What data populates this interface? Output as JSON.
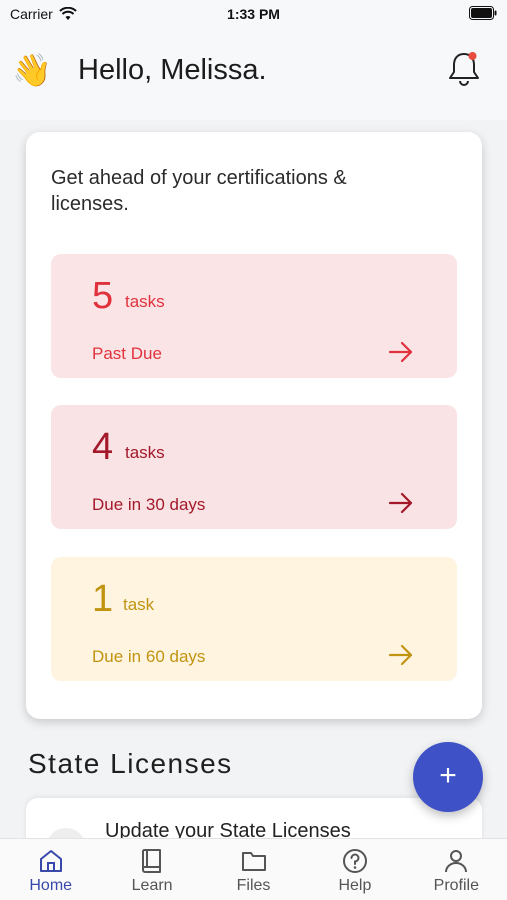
{
  "status_bar": {
    "carrier": "Carrier",
    "time": "1:33 PM"
  },
  "header": {
    "greeting": "Hello, Melissa.",
    "wave_emoji": "👋",
    "notification_icon": "bell-icon"
  },
  "summary_card": {
    "title": "Get ahead of your certifications & licenses.",
    "tasks": [
      {
        "count": "5",
        "unit": "tasks",
        "label": "Past Due",
        "color": "#e0323c",
        "background": "#fbe4e6"
      },
      {
        "count": "4",
        "unit": "tasks",
        "label": "Due in 30 days",
        "color": "#a3192a",
        "background": "#fae3e5"
      },
      {
        "count": "1",
        "unit": "task",
        "label": "Due in 60 days",
        "color": "#c09410",
        "background": "#fff4e0"
      }
    ]
  },
  "section": {
    "title": "State Licenses",
    "fab_label": "+"
  },
  "license_item": {
    "text": "Update your State Licenses"
  },
  "tabs": [
    {
      "label": "Home",
      "icon": "home-icon",
      "active": true
    },
    {
      "label": "Learn",
      "icon": "book-icon",
      "active": false
    },
    {
      "label": "Files",
      "icon": "folder-icon",
      "active": false
    },
    {
      "label": "Help",
      "icon": "help-icon",
      "active": false
    },
    {
      "label": "Profile",
      "icon": "person-icon",
      "active": false
    }
  ],
  "colors": {
    "accent": "#3949ab",
    "fab": "#3f51c7"
  }
}
